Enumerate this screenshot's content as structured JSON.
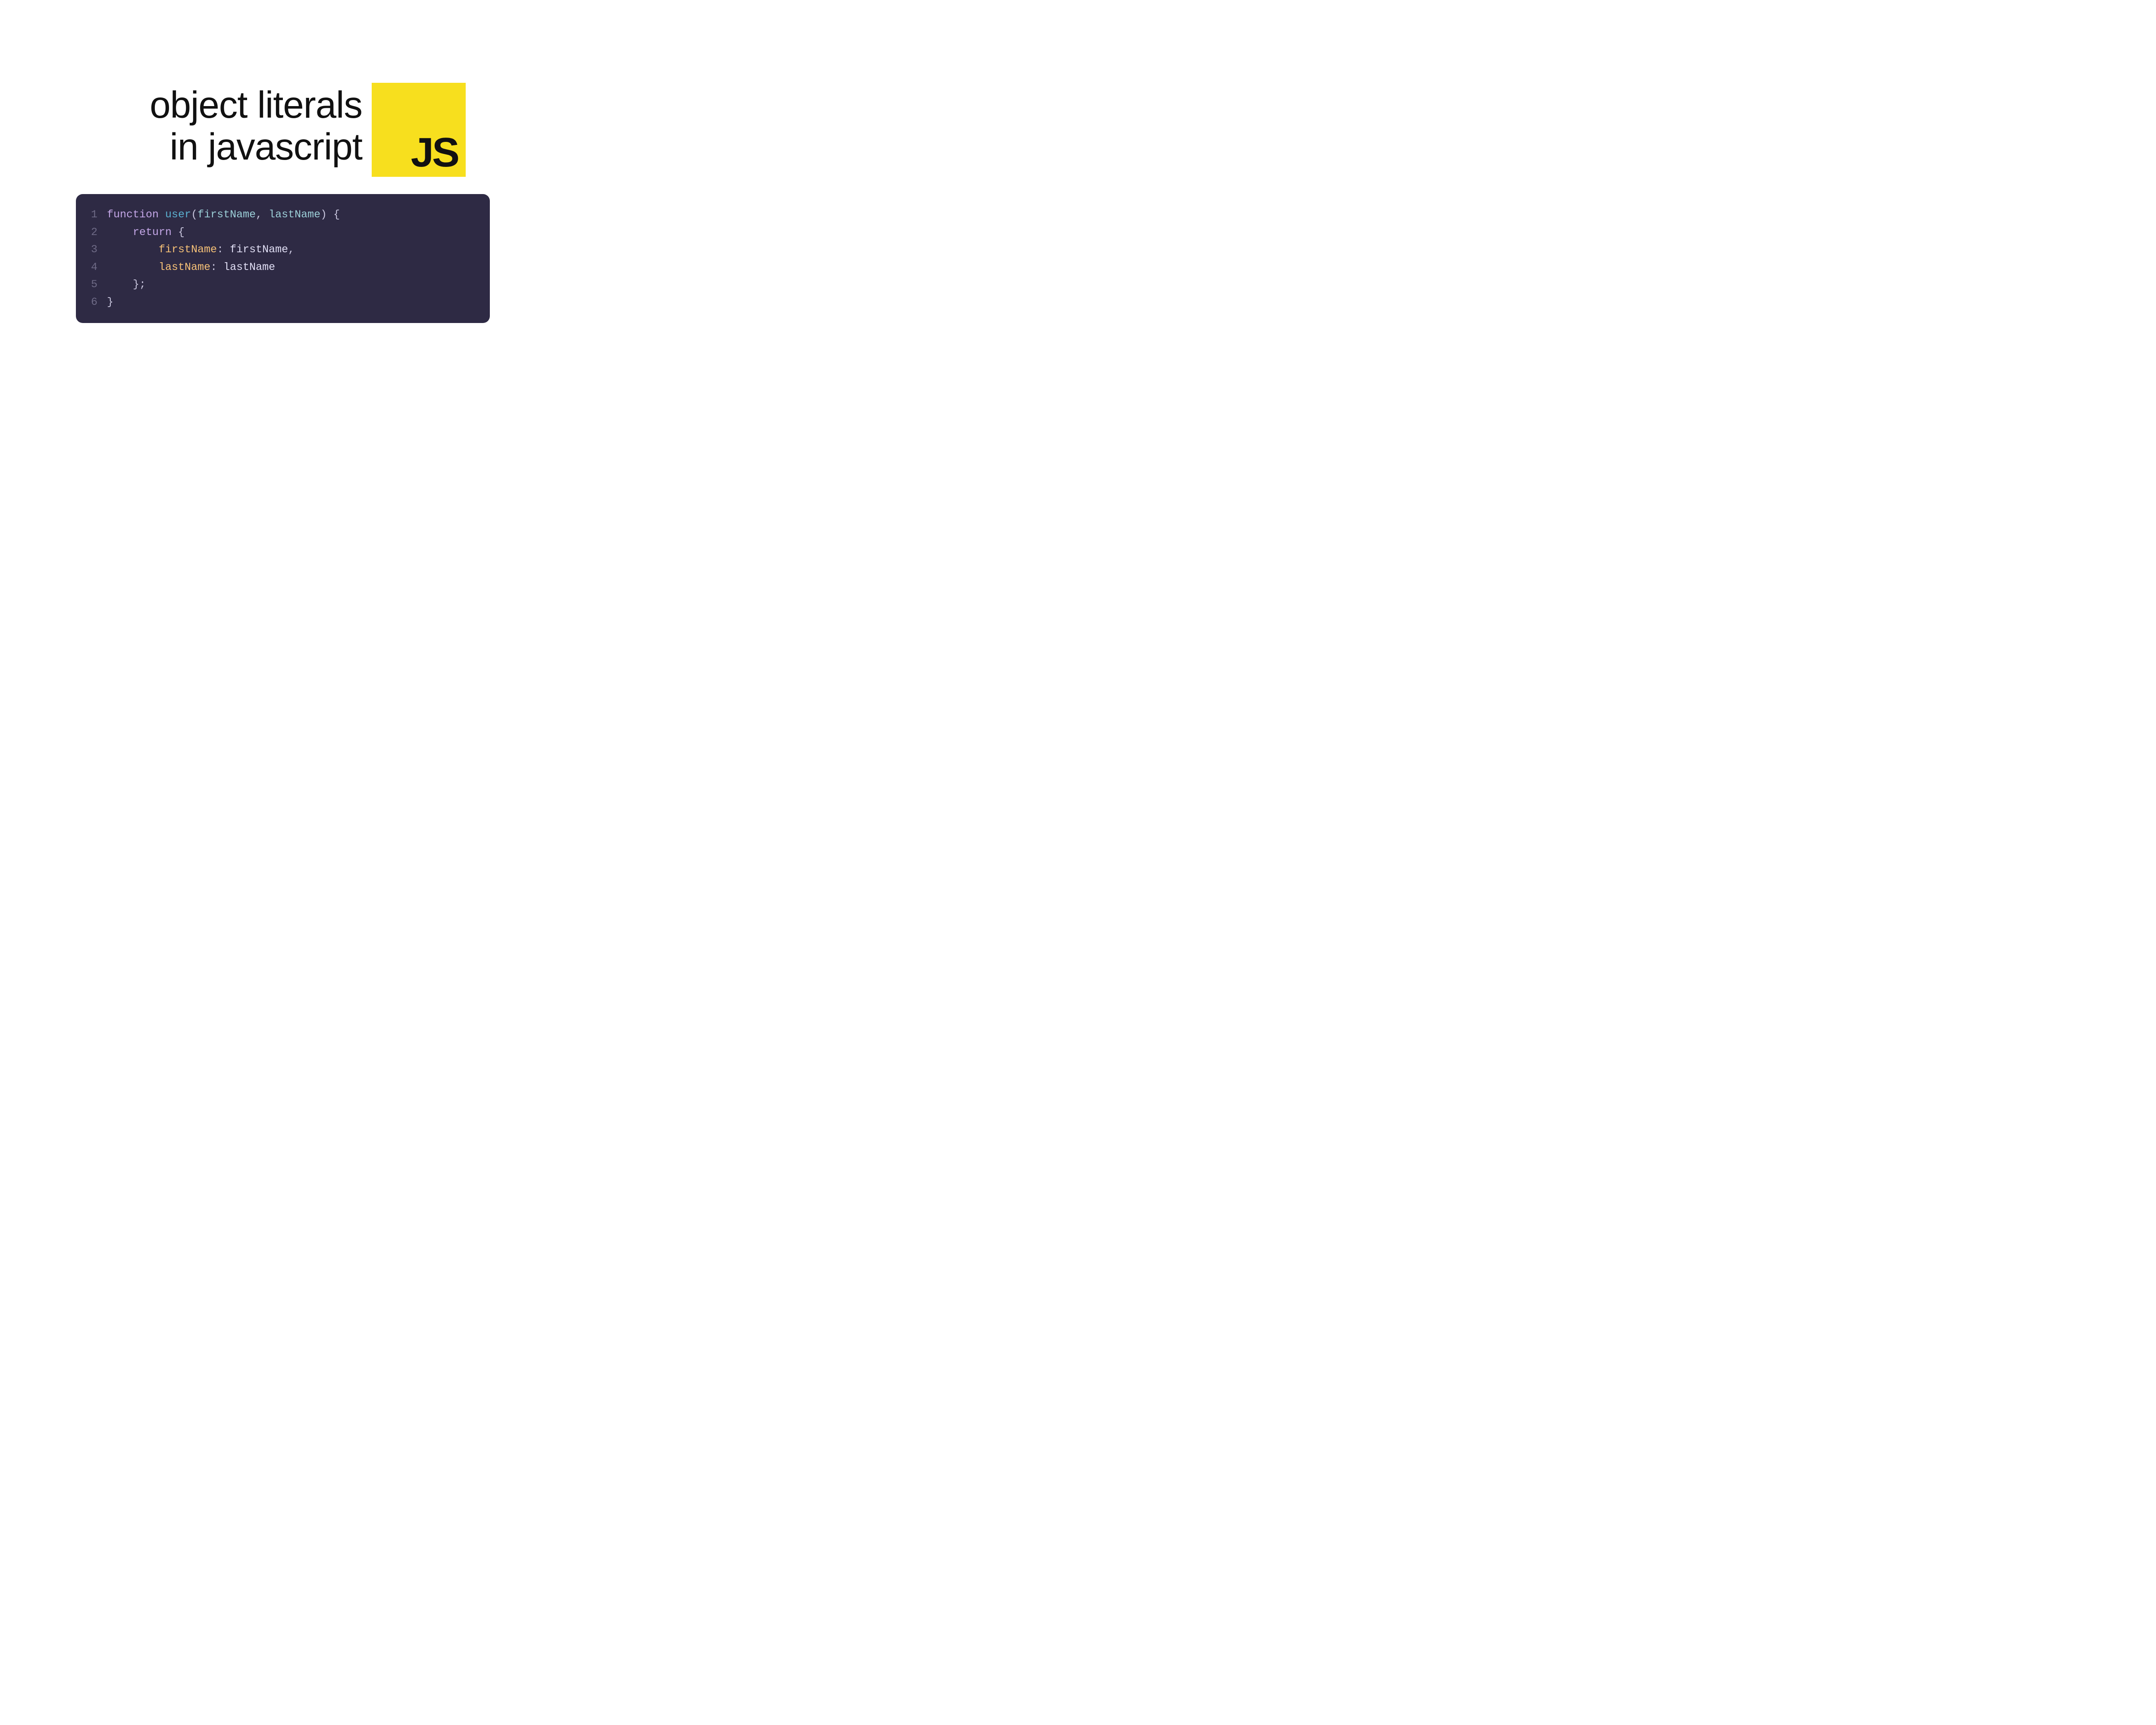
{
  "heading": {
    "line1": "object literals",
    "line2": "in javascript"
  },
  "logo": {
    "text": "JS",
    "bg": "#f7df1e"
  },
  "code": {
    "bg": "#2e2a44",
    "lines": [
      {
        "num": "1",
        "tokens": [
          {
            "t": "function",
            "c": "keyword"
          },
          {
            "t": " ",
            "c": "plain"
          },
          {
            "t": "user",
            "c": "fn"
          },
          {
            "t": "(",
            "c": "punc"
          },
          {
            "t": "firstName",
            "c": "param"
          },
          {
            "t": ", ",
            "c": "punc"
          },
          {
            "t": "lastName",
            "c": "param"
          },
          {
            "t": ") {",
            "c": "punc"
          }
        ]
      },
      {
        "num": "2",
        "tokens": [
          {
            "t": "    ",
            "c": "plain"
          },
          {
            "t": "return",
            "c": "keyword"
          },
          {
            "t": " {",
            "c": "punc"
          }
        ]
      },
      {
        "num": "3",
        "tokens": [
          {
            "t": "        ",
            "c": "plain"
          },
          {
            "t": "firstName",
            "c": "prop"
          },
          {
            "t": ": ",
            "c": "punc"
          },
          {
            "t": "firstName",
            "c": "plain"
          },
          {
            "t": ",",
            "c": "punc"
          }
        ]
      },
      {
        "num": "4",
        "tokens": [
          {
            "t": "        ",
            "c": "plain"
          },
          {
            "t": "lastName",
            "c": "prop"
          },
          {
            "t": ": ",
            "c": "punc"
          },
          {
            "t": "lastName",
            "c": "plain"
          }
        ]
      },
      {
        "num": "5",
        "tokens": [
          {
            "t": "    };",
            "c": "punc"
          }
        ]
      },
      {
        "num": "6",
        "tokens": [
          {
            "t": "}",
            "c": "punc"
          }
        ]
      }
    ]
  }
}
